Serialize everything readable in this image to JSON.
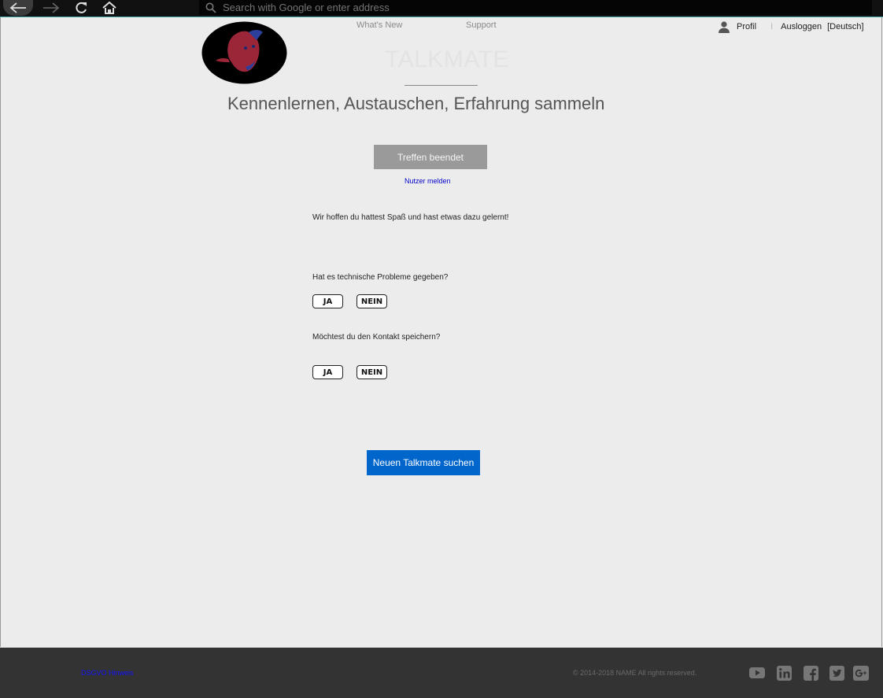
{
  "browser": {
    "address_placeholder": "Search with Google or enter address",
    "icons": [
      "back-arrow-icon",
      "forward-arrow-icon",
      "reload-icon",
      "home-icon",
      "search-icon"
    ]
  },
  "header": {
    "nav": [
      "What's New",
      "Support"
    ],
    "brand": "TALKMATE",
    "tagline": "Kennenlernen, Austauschen, Erfahrung sammeln",
    "profile_label": "Profil",
    "separator": "I",
    "logout_label": "Ausloggen",
    "language_label": "[Deutsch]"
  },
  "main": {
    "meeting_ended_label": "Treffen beendet",
    "report_user_label": "Nutzer melden",
    "thanks_text": "Wir hoffen du hattest Spaß und hast etwas dazu gelernt!",
    "question1": "Hat es technische Probleme gegeben?",
    "question2": "Möchtest du den Kontakt speichern?",
    "yes_label": "JA",
    "no_label": "NEIN",
    "find_new_label": "Neuen Talkmate suchen"
  },
  "footer": {
    "dsgvo_label": "DSGVO Hinweis",
    "copyright": "© 2014-2018 NAME All rights reserved.",
    "social": [
      "youtube-icon",
      "linkedin-icon",
      "facebook-icon",
      "twitter-icon",
      "google-plus-icon"
    ]
  },
  "colors": {
    "accent": "#0066cc",
    "ended_button": "#9a9a9a",
    "footer_bg": "#333333",
    "page_bg": "#ececec"
  }
}
